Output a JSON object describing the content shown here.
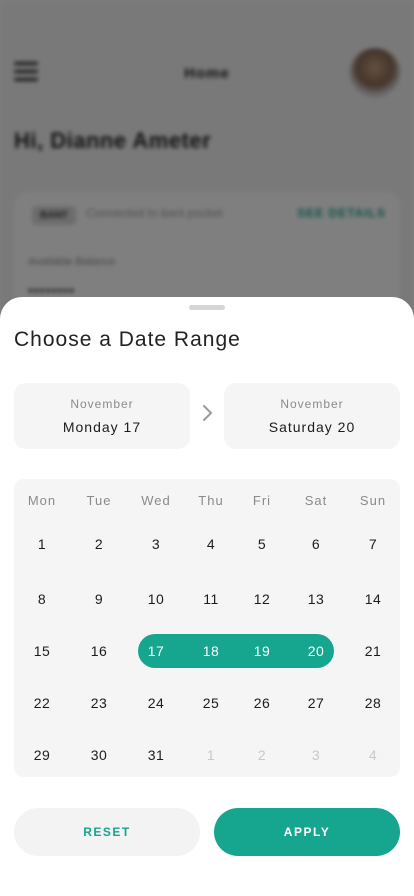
{
  "background": {
    "header_title": "Home",
    "greeting": "Hi, Dianne Ameter",
    "card": {
      "badge": "BANT",
      "status_text": "Connected to bant pocket",
      "details_link": "SEE DETAILS",
      "balance_label": "Available Balance",
      "balance_value": "••••••••"
    }
  },
  "sheet": {
    "title": "Choose a Date Range",
    "start": {
      "month": "November",
      "day": "Monday 17"
    },
    "end": {
      "month": "November",
      "day": "Saturday 20"
    },
    "weekdays": [
      "Mon",
      "Tue",
      "Wed",
      "Thu",
      "Fri",
      "Sat",
      "Sun"
    ],
    "weeks": [
      [
        "1",
        "2",
        "3",
        "4",
        "5",
        "6",
        "7"
      ],
      [
        "8",
        "9",
        "10",
        "11",
        "12",
        "13",
        "14"
      ],
      [
        "15",
        "16",
        "17",
        "18",
        "19",
        "20",
        "21"
      ],
      [
        "22",
        "23",
        "24",
        "25",
        "26",
        "27",
        "28"
      ],
      [
        "29",
        "30",
        "31",
        "1",
        "2",
        "3",
        "4"
      ]
    ],
    "selected_days": [
      "17",
      "18",
      "19",
      "20"
    ],
    "reset_label": "RESET",
    "apply_label": "APPLY"
  },
  "colors": {
    "accent": "#16a58f",
    "muted_day": "#c8c8c8"
  },
  "icons": {
    "menu": "hamburger-icon",
    "range_arrow": "chevron-right-icon"
  }
}
